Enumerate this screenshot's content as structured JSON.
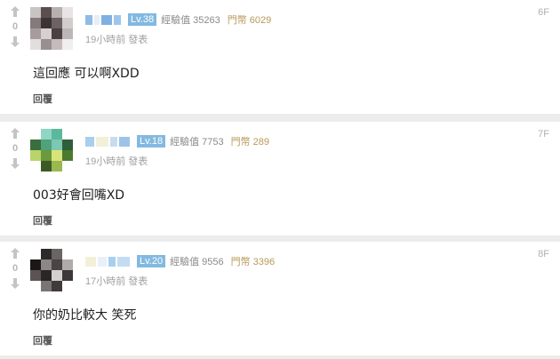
{
  "comments": [
    {
      "floor": "6F",
      "score": "0",
      "level": "Lv.38",
      "exp": "經驗值 35263",
      "coin": "門幣 6029",
      "time": "19小時前 發表",
      "body": "這回應 可以啊XDD",
      "reply": "回覆",
      "avatar_colors": [
        "#c9c4c4",
        "#5b4e4e",
        "#b7b0b0",
        "#e8e4e4",
        "#857a7a",
        "#3c3434",
        "#6e6262",
        "#d2cccc",
        "#a79c9c",
        "#d6d0d0",
        "#4a4040",
        "#bdb6b6",
        "#e2dede",
        "#9a8f8f",
        "#c4bcbc",
        "#f0eeee"
      ],
      "name_colors": [
        "#8fbce4",
        "#e6eef8",
        "#7eb0e0",
        "#9ec6ea"
      ]
    },
    {
      "floor": "7F",
      "score": "0",
      "level": "Lv.18",
      "exp": "經驗值 7753",
      "coin": "門幣 289",
      "time": "19小時前 發表",
      "body": "003好會回嘴XD",
      "reply": "回覆",
      "avatar_colors": [
        "#ffffff",
        "#8fd6c4",
        "#5cb89a",
        "#ffffff",
        "#3a6e3e",
        "#4fa27c",
        "#7cc8b2",
        "#2f5e3a",
        "#b9d46a",
        "#6a9a3c",
        "#d8e47a",
        "#4a7a2e",
        "#ffffff",
        "#3e5a24",
        "#9ab850",
        "#ffffff"
      ],
      "name_colors": [
        "#a8cfee",
        "#f2f0d8",
        "#c8dcf0",
        "#9cc4ea"
      ]
    },
    {
      "floor": "8F",
      "score": "0",
      "level": "Lv.20",
      "exp": "經驗值 9556",
      "coin": "門幣 3396",
      "time": "17小時前 發表",
      "body": "你的奶比較大 笑死",
      "reply": "回覆",
      "avatar_colors": [
        "#ffffff",
        "#2e2a2a",
        "#6a6464",
        "#ffffff",
        "#1c1818",
        "#8c8686",
        "#4a4444",
        "#b0aaaa",
        "#5a5454",
        "#2a2626",
        "#d4d0d0",
        "#3c3838",
        "#ffffff",
        "#7a7474",
        "#403a3a",
        "#ffffff"
      ],
      "name_colors": [
        "#f4f0d8",
        "#e8f0f8",
        "#a8cfee",
        "#c4dcf2"
      ]
    }
  ]
}
